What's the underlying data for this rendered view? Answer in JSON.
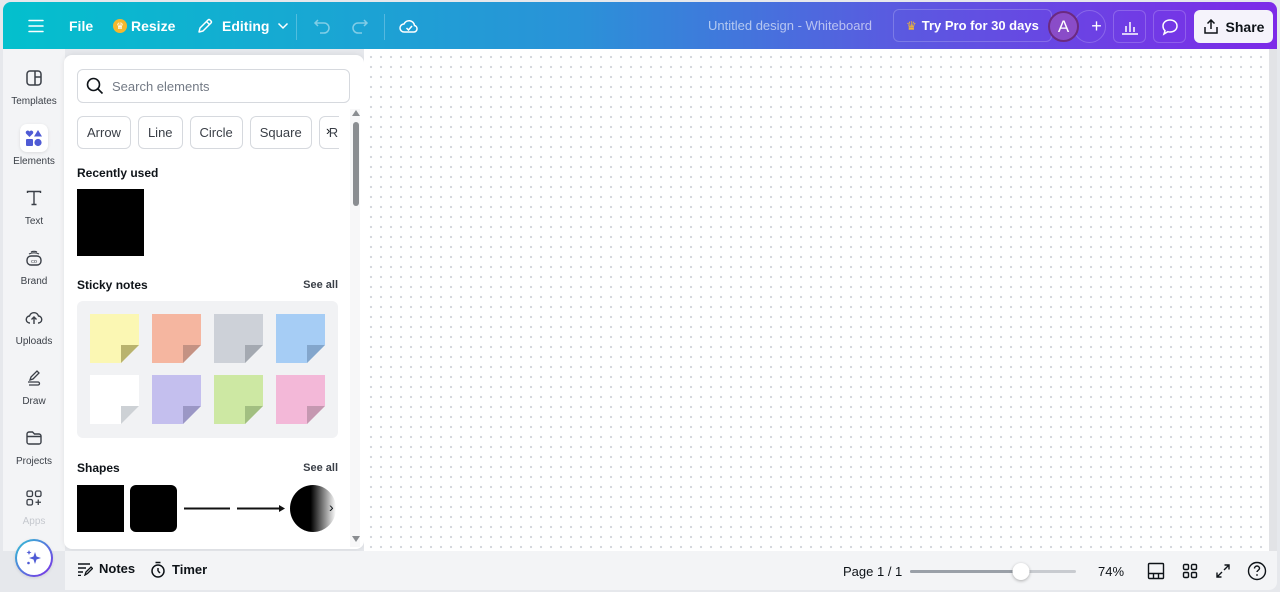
{
  "topbar": {
    "menu_icon": "hamburger-icon",
    "file_label": "File",
    "resize_label": "Resize",
    "editing_label": "Editing",
    "doc_title": "Untitled design - Whiteboard",
    "pro_label": "Try Pro for 30 days",
    "avatar_initial": "A",
    "add_label": "+",
    "share_label": "Share"
  },
  "rail": {
    "items": [
      {
        "label": "Templates",
        "icon": "templates-icon"
      },
      {
        "label": "Elements",
        "icon": "elements-icon",
        "active": true
      },
      {
        "label": "Text",
        "icon": "text-icon"
      },
      {
        "label": "Brand",
        "icon": "brand-icon"
      },
      {
        "label": "Uploads",
        "icon": "uploads-icon"
      },
      {
        "label": "Draw",
        "icon": "draw-icon"
      },
      {
        "label": "Projects",
        "icon": "projects-icon"
      },
      {
        "label": "Apps",
        "icon": "apps-icon"
      }
    ]
  },
  "panel": {
    "search_placeholder": "Search elements",
    "chips": [
      "Arrow",
      "Line",
      "Circle",
      "Square",
      "R"
    ],
    "recently_used_title": "Recently used",
    "sticky_title": "Sticky notes",
    "sticky_see_all": "See all",
    "sticky_colors": [
      "#fbf7b3",
      "#f5b6a0",
      "#cdd1d8",
      "#a6cdf5",
      "#ffffff",
      "#c4bfee",
      "#cde8a3",
      "#f3b8d8"
    ],
    "sticky_fold_colors": [
      "#b9b36e",
      "#c49283",
      "#a4a9b1",
      "#83a6cc",
      "#cdd1d5",
      "#9b97c5",
      "#a2bf81",
      "#c598b1"
    ],
    "shapes_title": "Shapes",
    "shapes_see_all": "See all"
  },
  "bottombar": {
    "notes_label": "Notes",
    "timer_label": "Timer",
    "page_label": "Page 1 / 1",
    "zoom_percent": 74,
    "zoom_label": "74%",
    "zoom_slider_fraction": 0.67
  }
}
